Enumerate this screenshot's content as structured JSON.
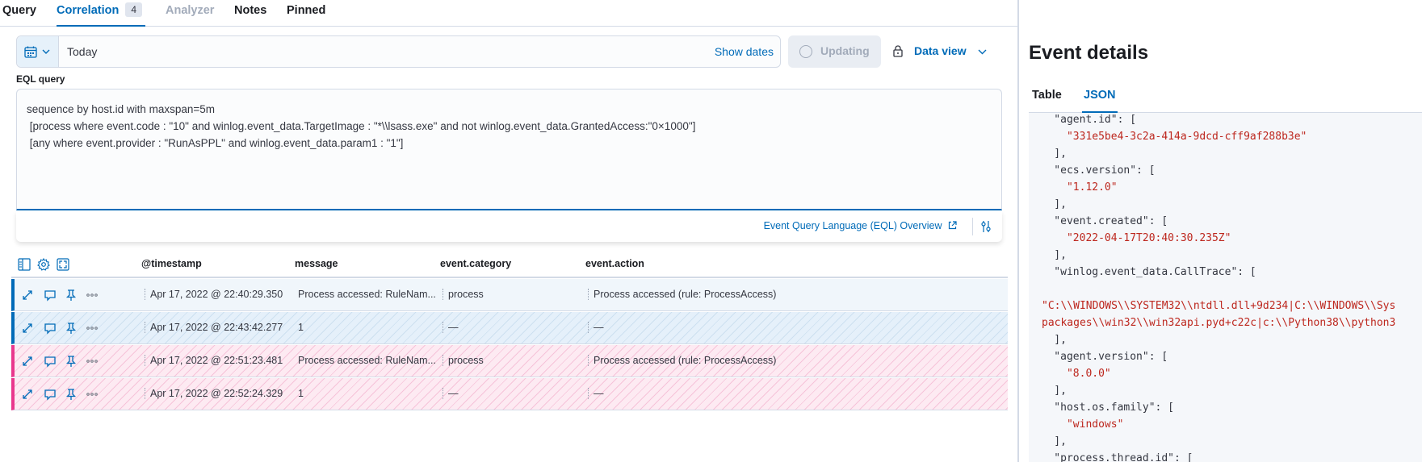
{
  "tabs": [
    {
      "label": "Query"
    },
    {
      "label": "Correlation",
      "badge": "4"
    },
    {
      "label": "Analyzer"
    },
    {
      "label": "Notes"
    },
    {
      "label": "Pinned"
    }
  ],
  "datepicker": {
    "value": "Today",
    "show_dates": "Show dates",
    "updating": "Updating",
    "data_view": "Data view"
  },
  "eql": {
    "label": "EQL query",
    "lines": [
      "sequence by host.id with maxspan=5m",
      " [process where event.code : \"10\" and winlog.event_data.TargetImage : \"*\\\\lsass.exe\" and not winlog.event_data.GrantedAccess:\"0×1000\"]",
      " [any where event.provider : \"RunAsPPL\" and winlog.event_data.param1 : \"1\"]"
    ],
    "overview_link": "Event Query Language (EQL) Overview"
  },
  "table": {
    "columns": [
      "@timestamp",
      "message",
      "event.category",
      "event.action"
    ],
    "rows": [
      {
        "timestamp": "Apr 17, 2022 @ 22:40:29.350",
        "message": "Process accessed: RuleNam...",
        "category": "process",
        "action": "Process accessed (rule: ProcessAccess)"
      },
      {
        "timestamp": "Apr 17, 2022 @ 22:43:42.277",
        "message": "1",
        "category": "—",
        "action": "—"
      },
      {
        "timestamp": "Apr 17, 2022 @ 22:51:23.481",
        "message": "Process accessed: RuleNam...",
        "category": "process",
        "action": "Process accessed (rule: ProcessAccess)"
      },
      {
        "timestamp": "Apr 17, 2022 @ 22:52:24.329",
        "message": "1",
        "category": "—",
        "action": "—"
      }
    ]
  },
  "event_details": {
    "title": "Event details",
    "tabs": [
      "Table",
      "JSON"
    ],
    "json_lines": [
      {
        "text": "    \"agent.id\": [",
        "str": false
      },
      {
        "text": "      \"331e5be4-3c2a-414a-9dcd-cff9af288b3e\"",
        "str": true
      },
      {
        "text": "    ],",
        "str": false
      },
      {
        "text": "    \"ecs.version\": [",
        "str": false
      },
      {
        "text": "      \"1.12.0\"",
        "str": true
      },
      {
        "text": "    ],",
        "str": false
      },
      {
        "text": "    \"event.created\": [",
        "str": false
      },
      {
        "text": "      \"2022-04-17T20:40:30.235Z\"",
        "str": true
      },
      {
        "text": "    ],",
        "str": false
      },
      {
        "text": "    \"winlog.event_data.CallTrace\": [",
        "str": false
      },
      {
        "text": "\"C:\\\\WINDOWS\\\\SYSTEM32\\\\ntdll.dll+9d234|C:\\\\WINDOWS\\\\Sys",
        "str": true
      },
      {
        "text": "packages\\\\win32\\\\win32api.pyd+c22c|c:\\\\Python38\\\\python3",
        "str": true
      },
      {
        "text": "    ],",
        "str": false
      },
      {
        "text": "    \"agent.version\": [",
        "str": false
      },
      {
        "text": "      \"8.0.0\"",
        "str": true
      },
      {
        "text": "    ],",
        "str": false
      },
      {
        "text": "    \"host.os.family\": [",
        "str": false
      },
      {
        "text": "      \"windows\"",
        "str": true
      },
      {
        "text": "    ],",
        "str": false
      },
      {
        "text": "    \"process.thread.id\": [",
        "str": false
      }
    ]
  }
}
